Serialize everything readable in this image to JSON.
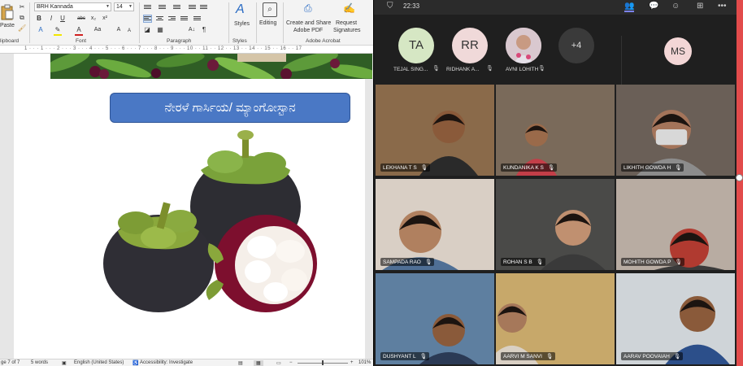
{
  "word": {
    "ribbon": {
      "font_name": "BRH Kannada",
      "font_size": "14",
      "paste_label": "Paste",
      "groups": {
        "clipboard": "lipboard",
        "font": "Font",
        "paragraph": "Paragraph",
        "styles": "Styles",
        "adobe": "Adobe Acrobat"
      },
      "styles_label": "Styles",
      "editing_label": "Editing",
      "create_share_line1": "Create and Share",
      "create_share_line2": "Adobe PDF",
      "request_line1": "Request",
      "request_line2": "Signatures"
    },
    "ruler_numbers": "1 · · · 1 · · · 2 · · · 3 · · · 4 · · · 5 · · · 6 · · · 7 · · · 8 · · · 9 · · · 10 · · 11 · · 12 · · 13 · · 14 · · 15 · · 16 · · 17",
    "document": {
      "title": "ನೇರಳೆ ಗಾರ್ಸಿಯ/ ಮ್ಯಾಂಗೋಸ್ಟಾನ"
    },
    "status": {
      "page": "ge 7 of 7",
      "words": "5 words",
      "language": "English (United States)",
      "accessibility": "Accessibility: Investigate",
      "zoom": "101%"
    }
  },
  "teams": {
    "time": "22:33",
    "top_avatars": [
      {
        "initials": "TA",
        "name": "TEJAL SING...",
        "color": "#d6e7c4"
      },
      {
        "initials": "RR",
        "name": "RIDHANK A...",
        "color": "#f0d9d9"
      },
      {
        "initials": "",
        "name": "AVNI LOHITH",
        "color": "#c9b7c0"
      },
      {
        "initials": "+4",
        "name": "",
        "color": "#3a3a3a"
      }
    ],
    "side_avatar": {
      "initials": "MS",
      "color": "#f3d6d6"
    },
    "tiles": [
      {
        "name": "LEKHANA T S"
      },
      {
        "name": "KUNDANIKA K S"
      },
      {
        "name": "LIKHITH GOWDA H"
      },
      {
        "name": "SAMPADA RAO"
      },
      {
        "name": "ROHAN S B"
      },
      {
        "name": "MOHITH GOWDA P"
      },
      {
        "name": "DUSHYANT L"
      },
      {
        "name": "AARVI M SANVI"
      },
      {
        "name": "AARAV POOVAIAH"
      }
    ]
  }
}
